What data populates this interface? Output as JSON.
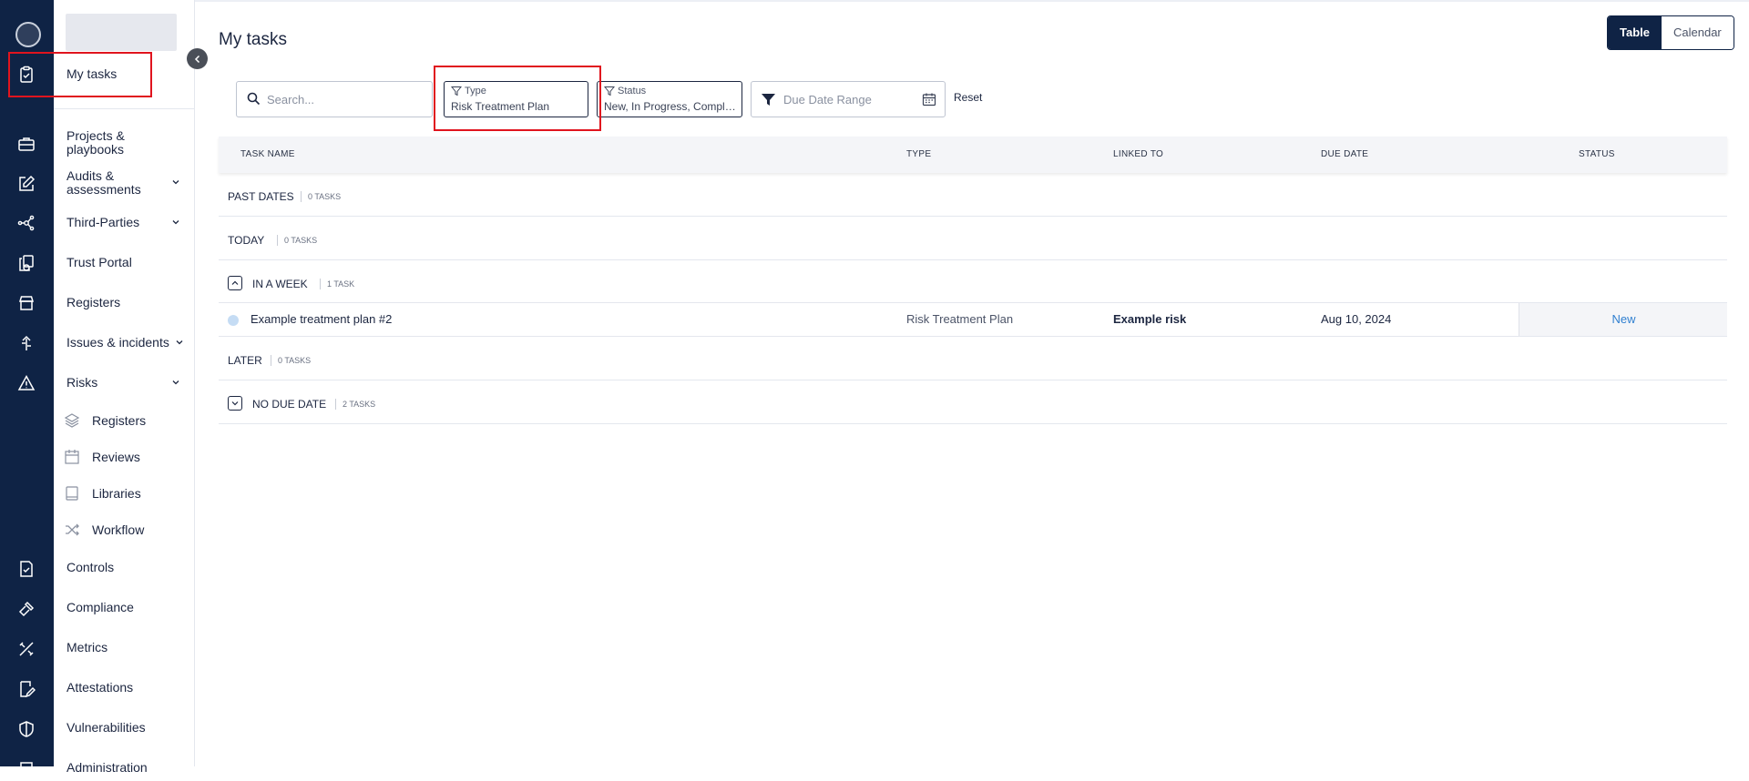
{
  "page": {
    "title": "My tasks"
  },
  "rail": {
    "icons": [
      "avatar",
      "clipboard-check-icon",
      "briefcase-icon",
      "pencil-square-icon",
      "network-icon",
      "documents-icon",
      "store-icon",
      "building-icon",
      "warning-triangle-icon",
      "document-check-icon",
      "hammer-icon",
      "tools-icon",
      "attestation-icon",
      "shield-icon",
      "settings-icon"
    ]
  },
  "nav": {
    "my_tasks": "My tasks",
    "projects": "Projects & playbooks",
    "audits": "Audits & assessments",
    "third_parties": "Third-Parties",
    "trust_portal": "Trust Portal",
    "registers": "Registers",
    "issues": "Issues & incidents",
    "risks": "Risks",
    "risks_sub": [
      "Registers",
      "Reviews",
      "Libraries",
      "Workflow"
    ],
    "controls": "Controls",
    "compliance": "Compliance",
    "metrics": "Metrics",
    "attestations": "Attestations",
    "vulnerabilities": "Vulnerabilities",
    "administration": "Administration"
  },
  "view_toggle": {
    "table": "Table",
    "calendar": "Calendar",
    "active": "Table"
  },
  "filters": {
    "search_placeholder": "Search...",
    "type_label": "Type",
    "type_value": "Risk Treatment Plan",
    "status_label": "Status",
    "status_value": "New, In Progress, Completed",
    "date_placeholder": "Due Date Range",
    "reset": "Reset"
  },
  "table": {
    "columns": [
      "TASK NAME",
      "TYPE",
      "LINKED TO",
      "DUE DATE",
      "STATUS"
    ],
    "groups": [
      {
        "title": "PAST DATES",
        "count": "0 TASKS"
      },
      {
        "title": "TODAY",
        "count": "0 TASKS"
      },
      {
        "title": "IN A WEEK",
        "count": "1 TASK",
        "expanded": true
      },
      {
        "title": "LATER",
        "count": "0 TASKS"
      },
      {
        "title": "NO DUE DATE",
        "count": "2 TASKS",
        "expanded": false
      }
    ],
    "rows": [
      {
        "name": "Example treatment plan #2",
        "type": "Risk Treatment Plan",
        "linked_to": "Example risk",
        "due_date": "Aug 10, 2024",
        "status": "New"
      }
    ]
  },
  "colors": {
    "rail": "#0f2345",
    "accent": "#2f7fd0",
    "highlight": "#e0141e"
  }
}
